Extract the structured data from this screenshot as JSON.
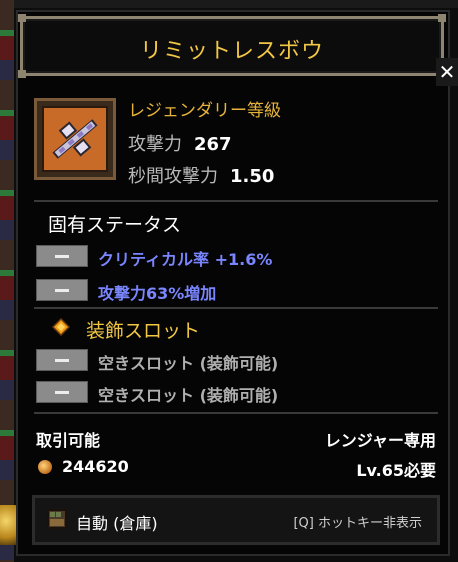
{
  "item": {
    "name": "リミットレスボウ",
    "rarity": "レジェンダリー等級",
    "stats": [
      {
        "label": "攻撃力",
        "value": "267"
      },
      {
        "label": "秒間攻撃力",
        "value": "1.50"
      }
    ]
  },
  "inherent": {
    "heading": "固有ステータス",
    "rows": [
      "クリティカル率 +1.6%",
      "攻撃力63%増加"
    ]
  },
  "slots": {
    "heading": "装飾スロット",
    "rows": [
      "空きスロット (装飾可能)",
      "空きスロット (装飾可能)"
    ]
  },
  "footer": {
    "tradable": "取引可能",
    "class_restriction": "レンジャー専用",
    "price": "244620",
    "level_req": "Lv.65必要"
  },
  "bottom_bar": {
    "auto_label": "自動 (倉庫)",
    "hotkey_label": "[Q] ホットキー非表示"
  },
  "close_label": "✕",
  "colors": {
    "title_gold": "#f2c744",
    "rarity_gold": "#e6b43a",
    "stat_blue": "#7a86ff",
    "frame": "#8d8570"
  },
  "icons": {
    "item": "crossbow-icon",
    "slot_gem": "gem-icon",
    "coin": "coin-icon",
    "storage": "chest-icon"
  }
}
